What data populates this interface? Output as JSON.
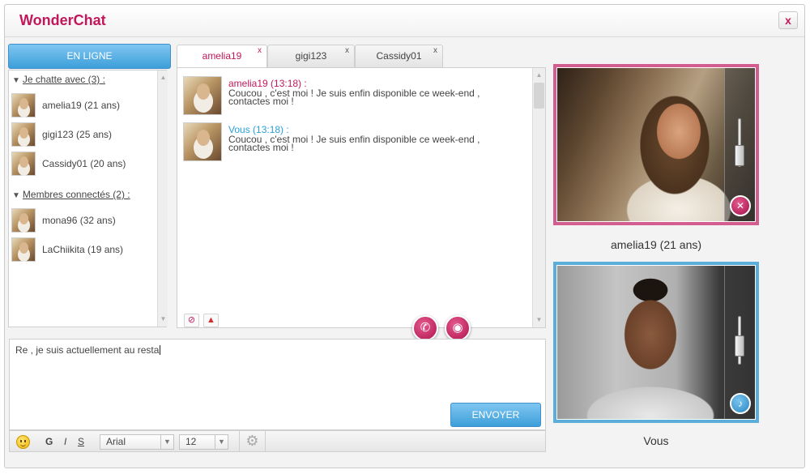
{
  "app": {
    "title": "WonderChat",
    "close_label": "x"
  },
  "online_button": "EN LIGNE",
  "groups": [
    {
      "title": "Je chatte avec (3) :",
      "contacts": [
        "amelia19 (21 ans)",
        "gigi123 (25 ans)",
        "Cassidy01 (20 ans)"
      ]
    },
    {
      "title": "Membres connectés (2) :",
      "contacts": [
        "mona96 (32 ans)",
        "LaChiikita (19 ans)"
      ]
    }
  ],
  "tabs": [
    {
      "label": "amelia19",
      "close": "x",
      "active": true
    },
    {
      "label": "gigi123",
      "close": "x",
      "active": false
    },
    {
      "label": "Cassidy01",
      "close": "x",
      "active": false
    }
  ],
  "messages": [
    {
      "author": "amelia19 (13:18) :",
      "line1": "Coucou , c'est moi ! Je suis enfin disponible ce week-end ,",
      "line2": "contactes moi !"
    },
    {
      "author": "Vous (13:18) :",
      "line1": "Coucou , c'est moi ! Je suis enfin disponible ce week-end ,",
      "line2": "contactes moi !"
    }
  ],
  "input": {
    "value": "Re , je suis actuellement au resta"
  },
  "send_button": "ENVOYER",
  "toolbar": {
    "bold": "G",
    "italic": "I",
    "underline": "S",
    "font": "Arial",
    "size": "12"
  },
  "video": {
    "remote_caption": "amelia19 (21 ans)",
    "local_caption": "Vous",
    "remote_volume": 0.45,
    "local_volume": 0.6
  },
  "colors": {
    "accent_pink": "#c2185b",
    "accent_blue": "#3d9fd9"
  }
}
